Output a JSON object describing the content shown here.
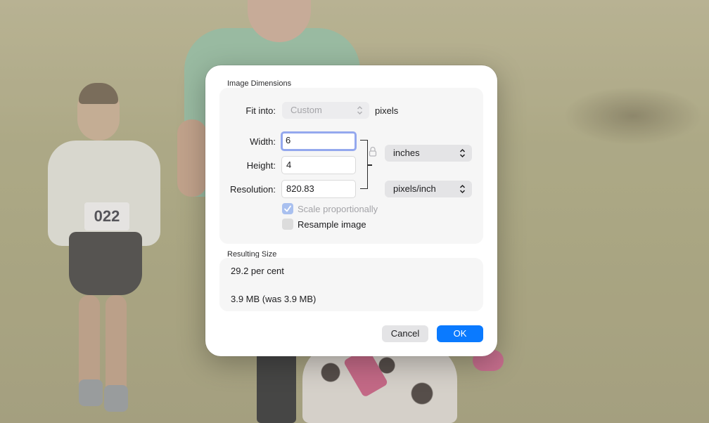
{
  "dialog": {
    "image_dimensions": {
      "title": "Image Dimensions",
      "fit_into": {
        "label": "Fit into:",
        "value": "Custom",
        "unit": "pixels"
      },
      "width": {
        "label": "Width:",
        "value": "6"
      },
      "height": {
        "label": "Height:",
        "value": "4"
      },
      "resolution": {
        "label": "Resolution:",
        "value": "820.83"
      },
      "size_unit": "inches",
      "resolution_unit": "pixels/inch",
      "scale_proportionally": {
        "label": "Scale proportionally",
        "checked": true
      },
      "resample_image": {
        "label": "Resample image",
        "checked": false
      }
    },
    "resulting_size": {
      "title": "Resulting Size",
      "percent": "29.2 per cent",
      "file_size": "3.9 MB (was 3.9 MB)"
    },
    "buttons": {
      "cancel": "Cancel",
      "ok": "OK"
    }
  },
  "background": {
    "bib_number": "022"
  },
  "colors": {
    "accent": "#0a7aff",
    "focus_ring": "#94a8ee",
    "checkbox_checked": "#a9c0ef"
  }
}
